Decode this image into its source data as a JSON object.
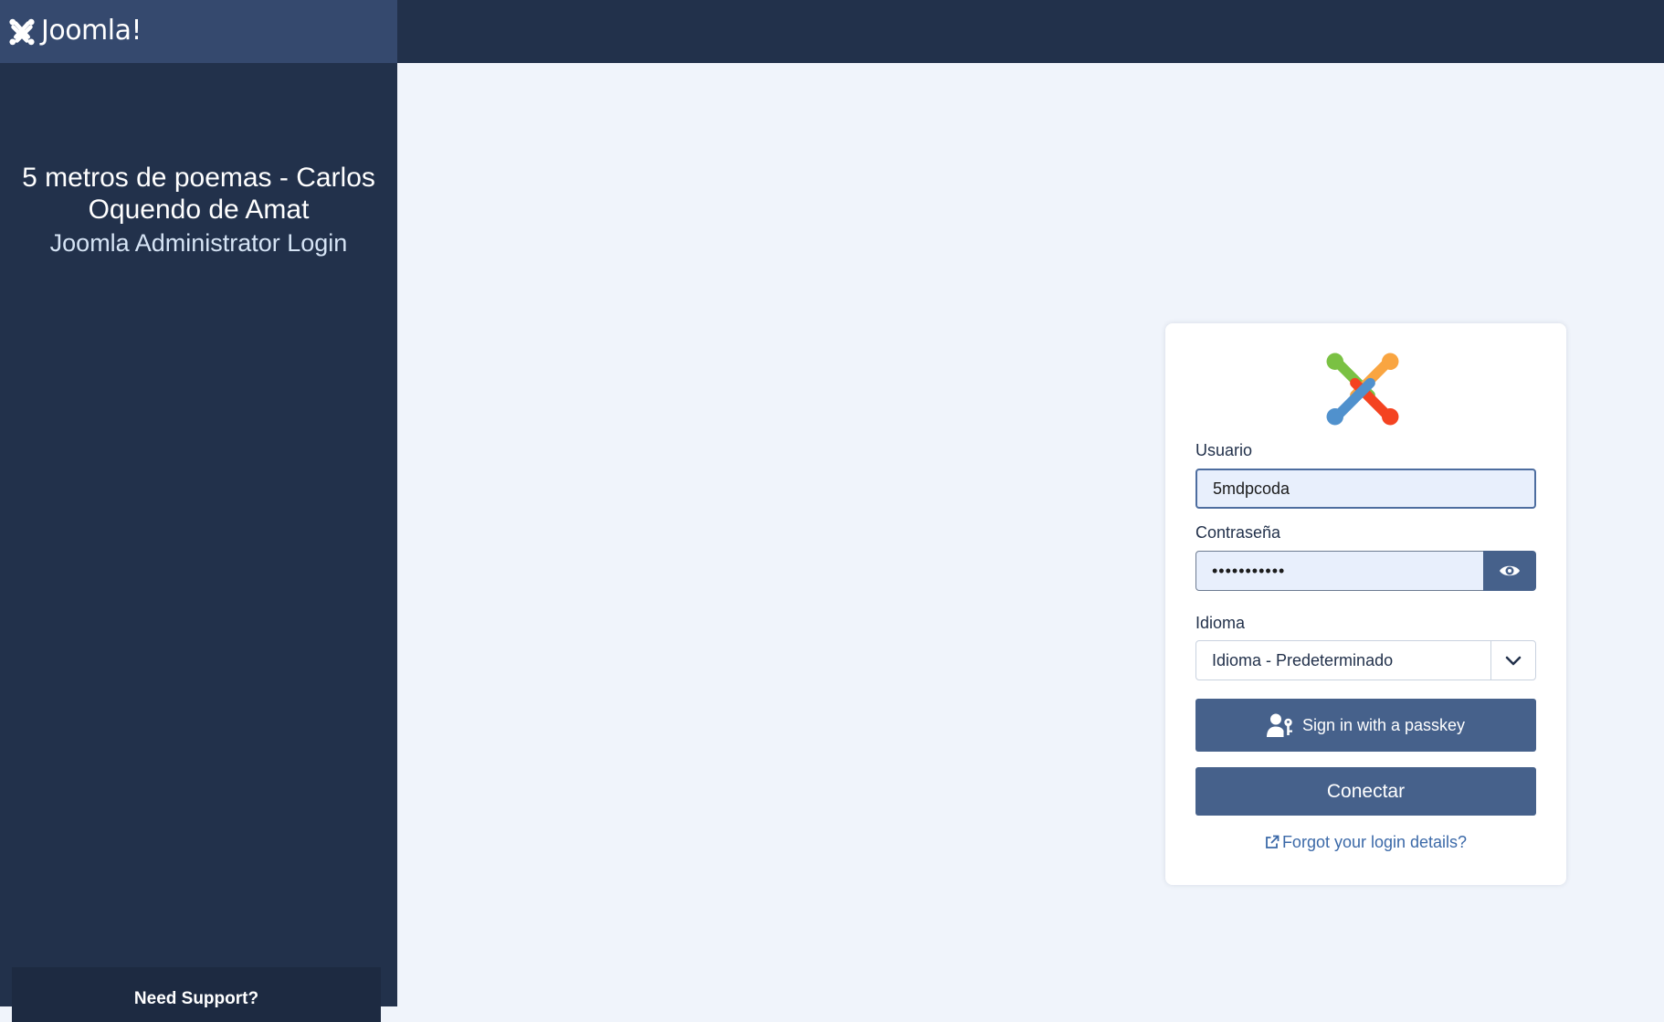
{
  "header": {
    "brand_text": "Joomla!",
    "brand_icon": "joomla-logo-icon"
  },
  "sidebar": {
    "site_name": "5 metros de poemas - Carlos Oquendo de Amat",
    "subtitle": "Joomla Administrator Login",
    "support_label": "Need Support?"
  },
  "login": {
    "logo_icon": "joomla-color-logo-icon",
    "username_label": "Usuario",
    "username_value": "5mdpcoda",
    "password_label": "Contraseña",
    "password_value": "•••••••••••",
    "show_password_icon": "eye-icon",
    "language_label": "Idioma",
    "language_value": "Idioma - Predeterminado",
    "passkey_label": "Sign in with a passkey",
    "passkey_icon": "user-key-icon",
    "submit_label": "Conectar",
    "forgot_label": "Forgot your login details?",
    "forgot_icon": "external-link-icon"
  },
  "colors": {
    "header_bg": "#22314b",
    "brand_bg": "#35496e",
    "page_bg": "#f0f4fb",
    "button_bg": "#46618b",
    "link": "#3b69a8",
    "logo_green": "#7ac143",
    "logo_orange": "#f9a541",
    "logo_red": "#f44321",
    "logo_blue": "#5091cd"
  }
}
